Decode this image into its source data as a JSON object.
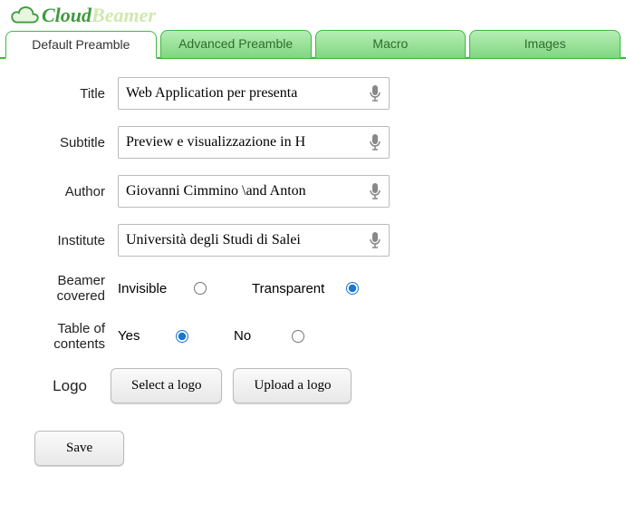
{
  "logo": {
    "part1": "Cloud",
    "part2": "Beamer"
  },
  "tabs": {
    "t0": "Default Preamble",
    "t1": "Advanced Preamble",
    "t2": "Macro",
    "t3": "Images"
  },
  "fields": {
    "title_label": "Title",
    "title_value": "Web Application per presenta",
    "subtitle_label": "Subtitle",
    "subtitle_value": "Preview e visualizzazione in H",
    "author_label": "Author",
    "author_value": "Giovanni Cimmino \\and Anton",
    "institute_label": "Institute",
    "institute_value": "Università degli Studi di Salei"
  },
  "beamer": {
    "label": "Beamer covered",
    "opt1": "Invisible",
    "opt2": "Transparent",
    "selected": "Transparent"
  },
  "toc": {
    "label": "Table of contents",
    "opt1": "Yes",
    "opt2": "No",
    "selected": "Yes"
  },
  "logo_row": {
    "label": "Logo",
    "select_btn": "Select a logo",
    "upload_btn": "Upload a logo"
  },
  "save_btn": "Save"
}
